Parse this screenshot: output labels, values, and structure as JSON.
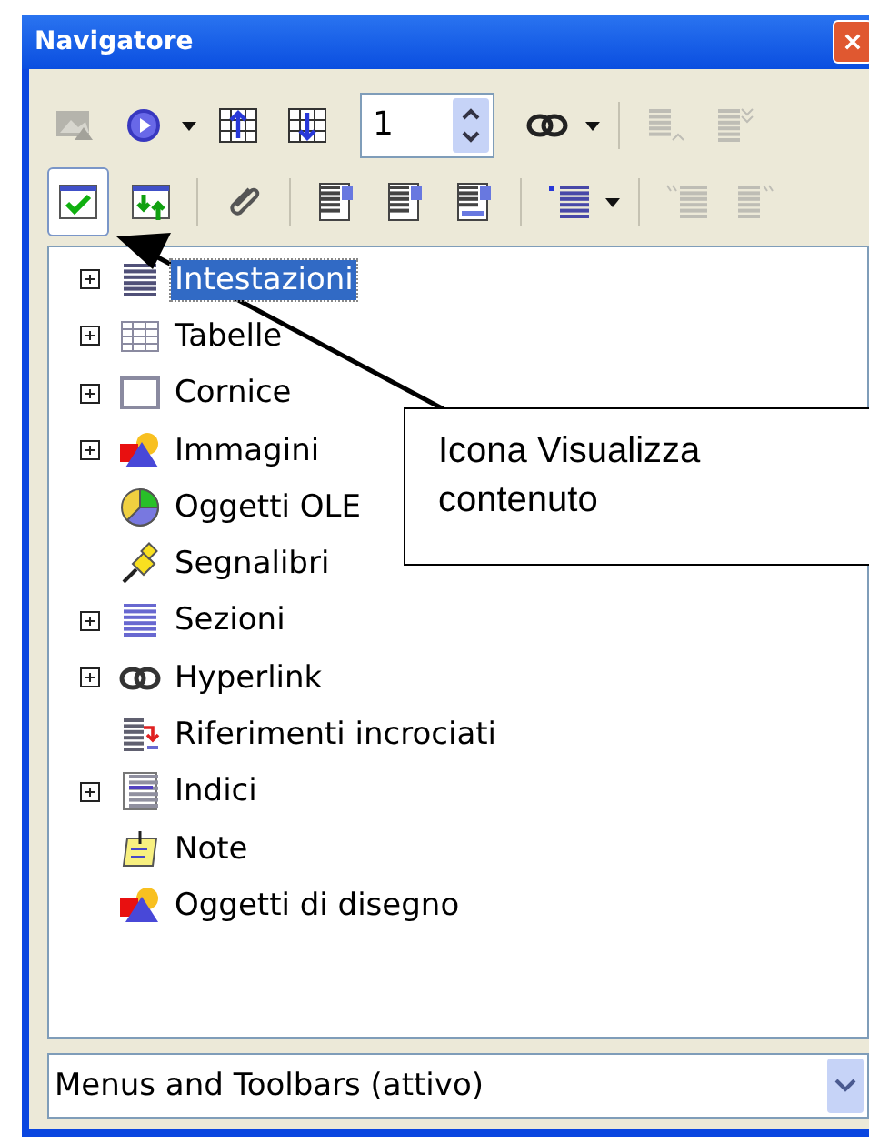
{
  "window": {
    "title": "Navigatore"
  },
  "toolbar": {
    "rows": [
      [
        {
          "kind": "button",
          "disabled": true
        },
        {
          "kind": "dropdown",
          "disabled": false
        },
        {
          "kind": "button",
          "disabled": false
        },
        {
          "kind": "button",
          "disabled": false
        },
        {
          "kind": "spin",
          "value": "1"
        },
        {
          "kind": "dropdown",
          "disabled": false
        },
        {
          "kind": "separator"
        },
        {
          "kind": "button",
          "disabled": true
        },
        {
          "kind": "button",
          "disabled": true
        }
      ],
      [
        {
          "kind": "button",
          "disabled": false,
          "pressed": true
        },
        {
          "kind": "button",
          "disabled": false,
          "pressed": false
        },
        {
          "kind": "separator"
        },
        {
          "kind": "button",
          "disabled": false,
          "pressed": false
        },
        {
          "kind": "separator"
        },
        {
          "kind": "button",
          "disabled": false,
          "pressed": false
        },
        {
          "kind": "button",
          "disabled": false,
          "pressed": false
        },
        {
          "kind": "button",
          "disabled": false,
          "pressed": false
        },
        {
          "kind": "separator"
        },
        {
          "kind": "dropdown",
          "disabled": false
        },
        {
          "kind": "separator"
        },
        {
          "kind": "button",
          "disabled": true
        },
        {
          "kind": "button",
          "disabled": true
        }
      ]
    ]
  },
  "tree": {
    "items": [
      {
        "label": "Intestazioni",
        "expandable": true,
        "selected": true
      },
      {
        "label": "Tabelle",
        "expandable": true,
        "selected": false
      },
      {
        "label": "Cornice",
        "expandable": true,
        "selected": false
      },
      {
        "label": "Immagini",
        "expandable": true,
        "selected": false
      },
      {
        "label": "Oggetti OLE",
        "expandable": false,
        "selected": false
      },
      {
        "label": "Segnalibri",
        "expandable": false,
        "selected": false
      },
      {
        "label": "Sezioni",
        "expandable": true,
        "selected": false
      },
      {
        "label": "Hyperlink",
        "expandable": true,
        "selected": false
      },
      {
        "label": "Riferimenti incrociati",
        "expandable": false,
        "selected": false
      },
      {
        "label": "Indici",
        "expandable": true,
        "selected": false
      },
      {
        "label": "Note",
        "expandable": false,
        "selected": false
      },
      {
        "label": "Oggetti di disegno",
        "expandable": false,
        "selected": false
      }
    ]
  },
  "document_select": {
    "value": "Menus and Toolbars (attivo)"
  },
  "callout": {
    "text": "Icona Visualizza contenuto"
  }
}
